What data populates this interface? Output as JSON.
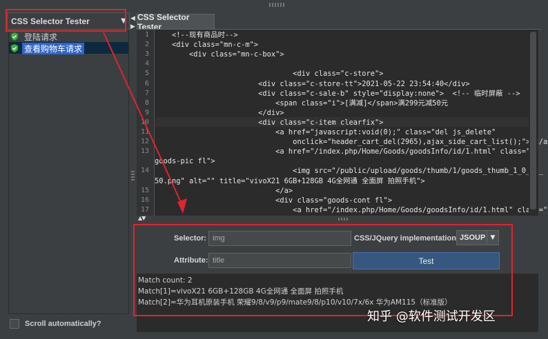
{
  "sidebar": {
    "dropdown_label": "CSS Selector Tester",
    "dropdown_arrow": "▼",
    "tree_items": [
      {
        "label": "登陆请求",
        "icon": "shield-check-icon"
      },
      {
        "label": "查看购物车请求",
        "icon": "shield-check-icon",
        "selected": true
      }
    ],
    "scroll_auto_label": "Scroll automatically?"
  },
  "tab": {
    "label": "CSS Selector Tester"
  },
  "editor": {
    "lines": [
      {
        "n": "1",
        "text": "    <!--现有商品时-->"
      },
      {
        "n": "2",
        "text": "    <div class=\"mn-c-m\">"
      },
      {
        "n": "3",
        "text": "        <div class=\"mn-c-box\">"
      },
      {
        "n": "4",
        "text": ""
      },
      {
        "n": "5",
        "text": "                                <div class=\"c-store\">"
      },
      {
        "n": "6",
        "text": "                        <div class=\"c-store-tt\">2021-05-22 23:54:40</div>"
      },
      {
        "n": "7",
        "text": "                        <div class=\"c-sale-b\" style=\"display:none\">  <!-- 临时屏蔽 -->"
      },
      {
        "n": "8",
        "text": "                            <span class=\"i\">[满减]</span>满299元减50元"
      },
      {
        "n": "9",
        "text": "                        </div>"
      },
      {
        "n": "10",
        "text": "                        <div class=\"c-item clearfix\">"
      },
      {
        "n": "11",
        "text": "                            <a href=\"javascript:void(0);\" class=\"del js_delete\""
      },
      {
        "n": "12",
        "text": "                                onclick=\"header_cart_del(2965),ajax_side_cart_list();\">×</a>"
      },
      {
        "n": "13",
        "text": "                            <a href=\"/index.php/Home/Goods/goodsInfo/id/1.html\" class=\""
      },
      {
        "n": "",
        "text": "goods-pic fl\">"
      },
      {
        "n": "14",
        "text": "                                <img src=\"/public/upload/goods/thumb/1/goods_thumb_1_0_50_"
      },
      {
        "n": "",
        "text": "50.png\" alt=\"\" title=\"vivoX21 6GB+128GB 4G全网通 全面屏 拍照手机\">"
      },
      {
        "n": "15",
        "text": "                            </a>"
      },
      {
        "n": "16",
        "text": "                            <div class=\"goods-cont fl\">"
      },
      {
        "n": "17",
        "text": "                                <a href=\"/index.php/Home/Goods/goodsInfo/id/1.html\" class=\""
      },
      {
        "n": "",
        "text": "                    全网通 全面屏 拍照手机"
      }
    ]
  },
  "form": {
    "selector_label": "Selector:",
    "selector_value": "img",
    "impl_label": "CSS/JQuery implementation:",
    "impl_value": "JSOUP",
    "impl_arrow": "▼",
    "attribute_label": "Attribute:",
    "attribute_value": "title",
    "test_label": "Test"
  },
  "results": {
    "lines": [
      "Match count: 2",
      "Match[1]=vivoX21 6GB+128GB 4G全网通 全面屏 拍照手机",
      "Match[2]=华为耳机原装手机 荣耀9/8/v9/p9/mate9/8/p10/v10/7x/6x 华为AM115（标准版）"
    ]
  },
  "watermark": "知乎 @软件测试开发区",
  "colors": {
    "annotation": "#e0242e",
    "selection": "#2f65ca",
    "button": "#365880"
  }
}
